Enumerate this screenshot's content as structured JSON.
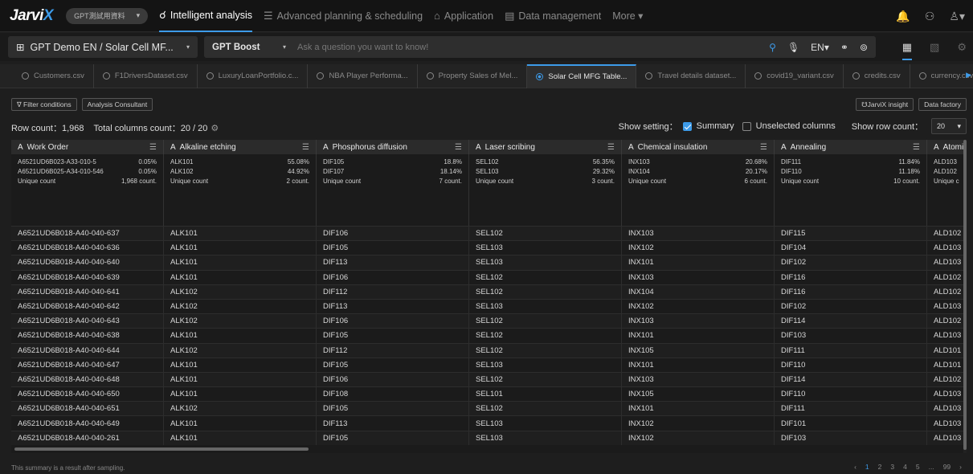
{
  "app": {
    "logo_text": "Jarvi",
    "logo_x": "X",
    "env_label": "GPT測試用資料",
    "env_chevron": "▾"
  },
  "nav": {
    "items": [
      {
        "icon": "☌",
        "label": "Intelligent analysis",
        "active": true
      },
      {
        "icon": "☰",
        "label": "Advanced planning & scheduling"
      },
      {
        "icon": "⌂",
        "label": "Application"
      },
      {
        "icon": "▤",
        "label": "Data management"
      }
    ],
    "more_label": "More ▾"
  },
  "header_right": {
    "bell_icon": "🔔",
    "org_icon": "⚇",
    "user_icon": "♙▾"
  },
  "toolbar": {
    "dataset_icon": "⊞",
    "dataset_label": "GPT Demo EN / Solar Cell MF...",
    "dataset_chevron": "▾",
    "mode_label": "GPT Boost",
    "mode_chevron": "▾",
    "ask_placeholder": "Ask a question you want to know!",
    "search_icon": "⚲",
    "mic_icon": "🎙",
    "lang_label": "EN▾",
    "node_icon": "⚭",
    "brain_icon": "⊚",
    "view_icons": [
      "▦",
      "▧",
      "⚙"
    ]
  },
  "file_tabs": [
    "Customers.csv",
    "F1DriversDataset.csv",
    "LuxuryLoanPortfolio.c...",
    "NBA Player Performa...",
    "Property Sales of Mel...",
    "Solar Cell MFG Table...",
    "Travel details dataset...",
    "covid19_variant.csv",
    "credits.csv",
    "currency.csv"
  ],
  "active_tab_index": 5,
  "actions": {
    "filter_label": "∇ Filter conditions",
    "consultant_label": "Analysis Consultant",
    "insight_label": "☋JarviX insight",
    "factory_label": "Data factory"
  },
  "stats": {
    "row_count": "Row count：1,968",
    "column_count": "Total columns count：20 / 20",
    "gear_icon": "⚙",
    "show_setting": "Show setting：",
    "summary_label": "Summary",
    "unselected_label": "Unselected columns",
    "row_count_label": "Show row count：",
    "row_count_value": "20",
    "row_count_chevron": "▾"
  },
  "table": {
    "columns": [
      {
        "name": "Work Order",
        "type_icon": "A",
        "menu_icon": "☰",
        "width": 190
      },
      {
        "name": "Alkaline etching",
        "type_icon": "A",
        "menu_icon": "☰",
        "width": 190
      },
      {
        "name": "Phosphorus diffusion",
        "type_icon": "A",
        "menu_icon": "☰",
        "width": 190
      },
      {
        "name": "Laser scribing",
        "type_icon": "A",
        "menu_icon": "☰",
        "width": 190
      },
      {
        "name": "Chemical insulation",
        "type_icon": "A",
        "menu_icon": "☰",
        "width": 190
      },
      {
        "name": "Annealing",
        "type_icon": "A",
        "menu_icon": "☰",
        "width": 190
      },
      {
        "name": "Atomi",
        "type_icon": "A",
        "menu_icon": "",
        "width": 49
      }
    ],
    "summary": [
      [
        [
          "A6521UD6B023-A33-010-5",
          "0.05%"
        ],
        [
          "A6521UD6B025-A34-010-546",
          "0.05%"
        ],
        [
          "Unique count",
          "1,968 count."
        ]
      ],
      [
        [
          "ALK101",
          "55.08%"
        ],
        [
          "ALK102",
          "44.92%"
        ],
        [
          "Unique count",
          "2 count."
        ]
      ],
      [
        [
          "DIF105",
          "18.8%"
        ],
        [
          "DIF107",
          "18.14%"
        ],
        [
          "Unique count",
          "7 count."
        ]
      ],
      [
        [
          "SEL102",
          "56.35%"
        ],
        [
          "SEL103",
          "29.32%"
        ],
        [
          "Unique count",
          "3 count."
        ]
      ],
      [
        [
          "INX103",
          "20.68%"
        ],
        [
          "INX104",
          "20.17%"
        ],
        [
          "Unique count",
          "6 count."
        ]
      ],
      [
        [
          "DIF111",
          "11.84%"
        ],
        [
          "DIF110",
          "11.18%"
        ],
        [
          "Unique count",
          "10 count."
        ]
      ],
      [
        [
          "ALD103",
          ""
        ],
        [
          "ALD102",
          ""
        ],
        [
          "Unique co",
          ""
        ]
      ]
    ],
    "rows": [
      [
        "A6521UD6B018-A40-040-637",
        "ALK101",
        "DIF106",
        "SEL102",
        "INX103",
        "DIF115",
        "ALD102"
      ],
      [
        "A6521UD6B018-A40-040-636",
        "ALK101",
        "DIF105",
        "SEL103",
        "INX102",
        "DIF104",
        "ALD103"
      ],
      [
        "A6521UD6B018-A40-040-640",
        "ALK101",
        "DIF113",
        "SEL103",
        "INX101",
        "DIF102",
        "ALD103"
      ],
      [
        "A6521UD6B018-A40-040-639",
        "ALK101",
        "DIF106",
        "SEL102",
        "INX103",
        "DIF116",
        "ALD102"
      ],
      [
        "A6521UD6B018-A40-040-641",
        "ALK102",
        "DIF112",
        "SEL102",
        "INX104",
        "DIF116",
        "ALD102"
      ],
      [
        "A6521UD6B018-A40-040-642",
        "ALK102",
        "DIF113",
        "SEL103",
        "INX102",
        "DIF102",
        "ALD103"
      ],
      [
        "A6521UD6B018-A40-040-643",
        "ALK102",
        "DIF106",
        "SEL102",
        "INX103",
        "DIF114",
        "ALD102"
      ],
      [
        "A6521UD6B018-A40-040-638",
        "ALK101",
        "DIF105",
        "SEL102",
        "INX101",
        "DIF103",
        "ALD103"
      ],
      [
        "A6521UD6B018-A40-040-644",
        "ALK102",
        "DIF112",
        "SEL102",
        "INX105",
        "DIF111",
        "ALD101"
      ],
      [
        "A6521UD6B018-A40-040-647",
        "ALK101",
        "DIF105",
        "SEL103",
        "INX101",
        "DIF110",
        "ALD101"
      ],
      [
        "A6521UD6B018-A40-040-648",
        "ALK101",
        "DIF106",
        "SEL102",
        "INX103",
        "DIF114",
        "ALD102"
      ],
      [
        "A6521UD6B018-A40-040-650",
        "ALK101",
        "DIF108",
        "SEL101",
        "INX105",
        "DIF110",
        "ALD103"
      ],
      [
        "A6521UD6B018-A40-040-651",
        "ALK102",
        "DIF105",
        "SEL102",
        "INX101",
        "DIF111",
        "ALD103"
      ],
      [
        "A6521UD6B018-A40-040-649",
        "ALK101",
        "DIF113",
        "SEL103",
        "INX102",
        "DIF101",
        "ALD103"
      ],
      [
        "A6521UD6B018-A40-040-261",
        "ALK101",
        "DIF105",
        "SEL103",
        "INX102",
        "DIF103",
        "ALD103"
      ]
    ]
  },
  "footer": {
    "note": "This summary is a result after sampling.",
    "pages": [
      "‹",
      "1",
      "2",
      "3",
      "4",
      "5",
      "...",
      "99",
      "›"
    ],
    "current_page": "1"
  },
  "colors": {
    "accent": "#3d9be9",
    "background": "#1e1e1e",
    "nav_bg": "#141414"
  }
}
